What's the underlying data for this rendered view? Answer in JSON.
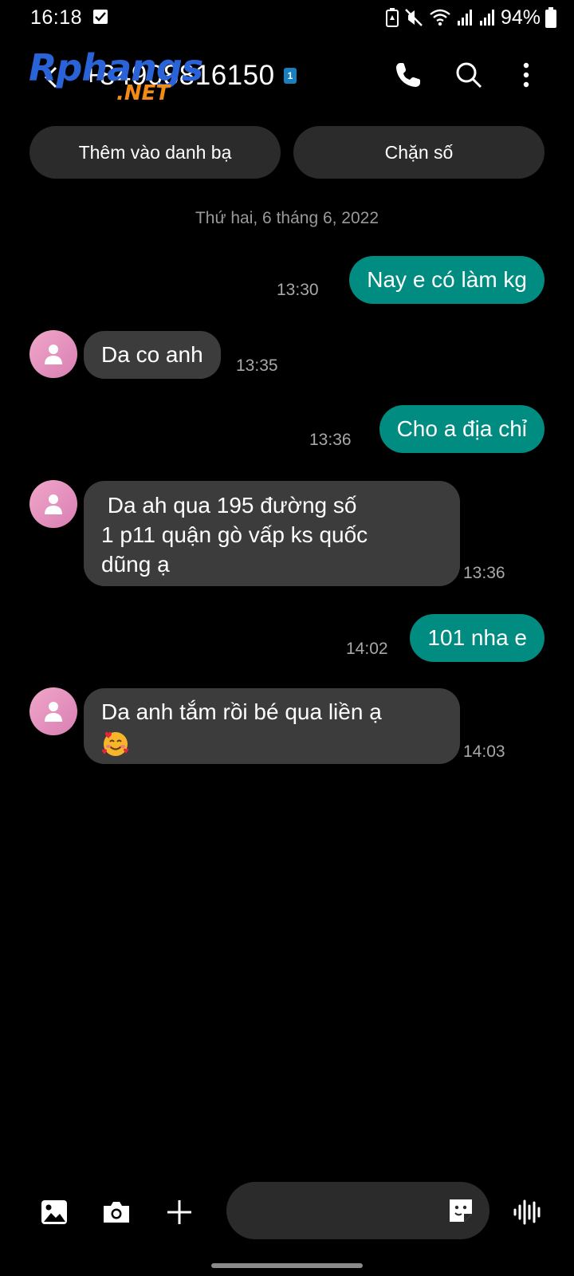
{
  "status_bar": {
    "time": "16:18",
    "battery_percent": "94%",
    "icons": [
      "checkbox-notification-icon",
      "battery-saver-icon",
      "mute-icon",
      "wifi-icon",
      "signal-icon",
      "signal-icon",
      "battery-icon"
    ]
  },
  "header": {
    "watermark_main": "Rphangs",
    "watermark_sub": ".NET",
    "phone_number": "+84908816150",
    "sim_badge": "1",
    "icons": [
      "back-icon",
      "call-icon",
      "search-icon",
      "more-options-icon"
    ]
  },
  "actions": {
    "add_contact": "Thêm vào danh bạ",
    "block_number": "Chặn số"
  },
  "date_separator": "Thứ hai, 6 tháng 6, 2022",
  "messages": [
    {
      "direction": "out",
      "text": "Nay e có làm kg",
      "time": "13:30"
    },
    {
      "direction": "in",
      "text": "Da co anh",
      "time": "13:35"
    },
    {
      "direction": "out",
      "text": "Cho a địa chỉ",
      "time": "13:36"
    },
    {
      "direction": "in",
      "lines": [
        " Da ah qua 195 đường số",
        "1 p11 quận gò vấp ks quốc",
        "dũng ạ"
      ],
      "time": "13:36"
    },
    {
      "direction": "out",
      "text": "101 nha e",
      "time": "14:02"
    },
    {
      "direction": "in",
      "text": "Da anh tắm rồi bé qua liền ạ",
      "emoji": "smiling-face-with-hearts",
      "time": "14:03"
    }
  ],
  "composer": {
    "input_value": "",
    "icons": [
      "gallery-icon",
      "camera-icon",
      "add-icon",
      "sticker-icon",
      "voice-icon"
    ]
  },
  "colors": {
    "background": "#000000",
    "outgoing_bubble": "#008c80",
    "incoming_bubble": "#3c3c3c",
    "chip": "#2b2b2b",
    "timestamp": "#a8a8a8"
  }
}
